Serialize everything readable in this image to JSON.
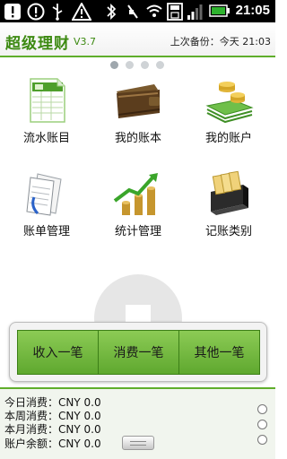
{
  "statusbar": {
    "time": "21:05",
    "icons": [
      "warning-icon",
      "alert-icon",
      "usb-icon",
      "triangle-warning-icon",
      "bluetooth-icon",
      "no-sound-icon",
      "wifi-icon",
      "save-icon",
      "signal-icon",
      "battery-icon"
    ]
  },
  "header": {
    "title": "超级理财",
    "version": "V3.7",
    "backup": "上次备份：今天 21:03"
  },
  "pager": {
    "count": 4,
    "active": 0
  },
  "grid": [
    {
      "label": "流水账目",
      "icon": "spreadsheet-icon"
    },
    {
      "label": "我的账本",
      "icon": "wallet-icon"
    },
    {
      "label": "我的账户",
      "icon": "money-stack-icon"
    },
    {
      "label": "账单管理",
      "icon": "documents-icon"
    },
    {
      "label": "统计管理",
      "icon": "growth-chart-icon"
    },
    {
      "label": "记账类别",
      "icon": "card-file-icon"
    }
  ],
  "actions": {
    "income": "收入一笔",
    "expense": "消费一笔",
    "other": "其他一笔"
  },
  "summary": {
    "today": "今日消费：CNY 0.0",
    "week": "本周消费：CNY 0.0",
    "month": "本月消费：CNY 0.0",
    "balance": "账户余额：CNY 0.0"
  },
  "colors": {
    "accent": "#5fae2b",
    "title": "#3d8a12",
    "button": "#6ab33a"
  }
}
